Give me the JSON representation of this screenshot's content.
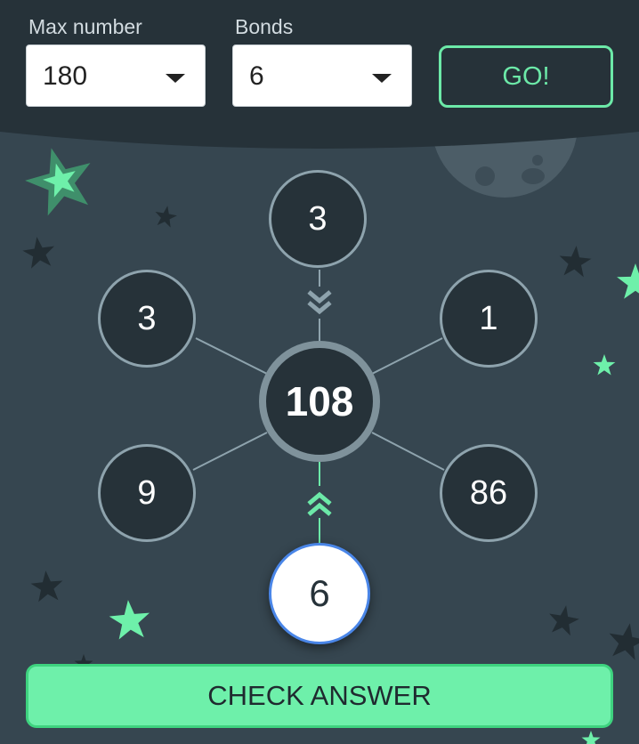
{
  "controls": {
    "max_number_label": "Max number",
    "max_number_value": "180",
    "bonds_label": "Bonds",
    "bonds_value": "6",
    "go_label": "GO!"
  },
  "puzzle": {
    "center": "108",
    "top": "3",
    "upper_left": "3",
    "upper_right": "1",
    "lower_left": "9",
    "lower_right": "86",
    "answer": "6"
  },
  "check_button_label": "CHECK ANSWER",
  "colors": {
    "background": "#364650",
    "header": "#263239",
    "accent": "#6ce9a8",
    "node_fill": "#263239",
    "answer_border": "#4a86e8"
  },
  "icons": [
    "caret-down-icon",
    "star-icon",
    "moon-icon",
    "chevron-down-icon",
    "chevron-up-icon"
  ]
}
